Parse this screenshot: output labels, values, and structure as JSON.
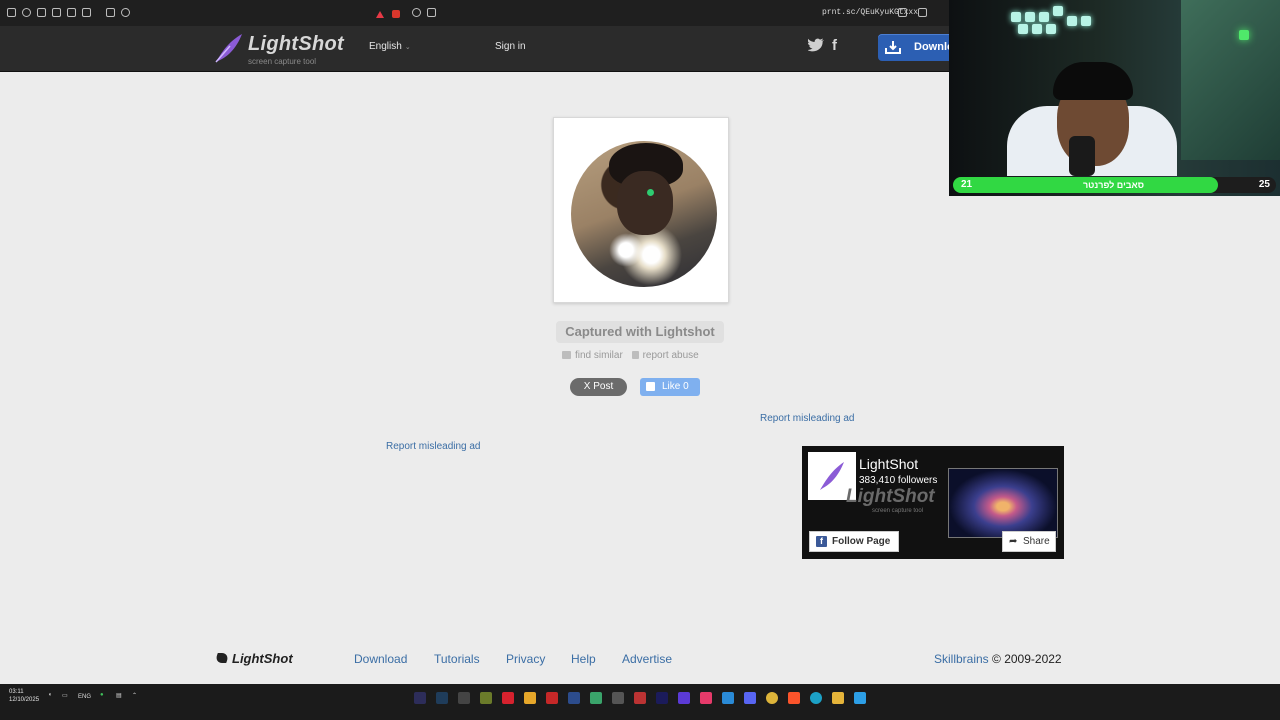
{
  "browser": {
    "url": "prnt.sc/QEuKyuKGtxxx"
  },
  "header": {
    "brand": "LightShot",
    "tagline": "screen capture tool",
    "language": "English",
    "signin": "Sign in",
    "download": "Download"
  },
  "screenshot": {
    "caption": "Captured with Lightshot",
    "find_similar": "find similar",
    "report_abuse": "report abuse"
  },
  "social": {
    "post": "X Post",
    "like": "Like 0"
  },
  "ads": {
    "report_right": "Report misleading ad",
    "report_left": "Report misleading ad"
  },
  "fb_widget": {
    "name": "LightShot",
    "followers": "383,410 followers",
    "watermark": "LightShot",
    "watermark_sub": "screen capture tool",
    "follow": "Follow Page",
    "share": "Share"
  },
  "footer": {
    "brand": "LightShot",
    "nav": [
      "Download",
      "Tutorials",
      "Privacy",
      "Help",
      "Advertise"
    ],
    "company": "Skillbrains",
    "copyright": " © 2009-2022"
  },
  "taskbar": {
    "time": "03:11",
    "date": "12/10/2025",
    "lang": "ENG"
  },
  "webcam": {
    "left_value": "21",
    "center_text": "סאבים לפרנטר",
    "right_value": "25",
    "progress": 0.82,
    "bar_color": "#31d843"
  }
}
